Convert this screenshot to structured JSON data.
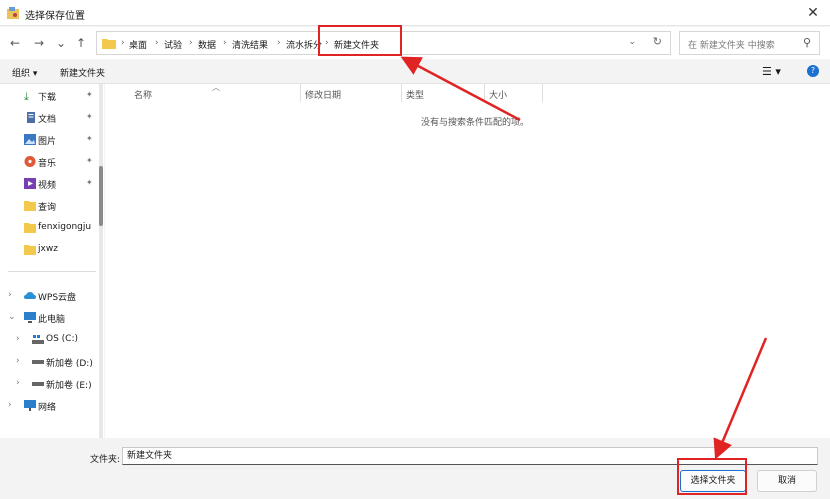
{
  "window": {
    "title": "选择保存位置",
    "close_glyph": "✕"
  },
  "nav": {
    "back": "←",
    "forward": "→",
    "recent": "⌄",
    "up": "↑"
  },
  "address": {
    "crumbs": [
      "桌面",
      "试验",
      "数据",
      "清洗结果",
      "流水拆分",
      "新建文件夹"
    ],
    "separator": "›",
    "dropdown": "⌄",
    "refresh": "↻"
  },
  "search": {
    "placeholder": "在 新建文件夹 中搜索",
    "icon": "⚲"
  },
  "toolbar": {
    "organize": "组织 ▾",
    "new_folder": "新建文件夹",
    "view": "☰ ▾",
    "help": "?"
  },
  "sidebar": {
    "items": [
      {
        "label": "下载",
        "pinned": true
      },
      {
        "label": "文档",
        "pinned": true
      },
      {
        "label": "图片",
        "pinned": true
      },
      {
        "label": "音乐",
        "pinned": true
      },
      {
        "label": "视频",
        "pinned": true
      },
      {
        "label": "查询"
      },
      {
        "label": "fenxigongju"
      },
      {
        "label": "jxwz"
      },
      {
        "label": "WPS云盘"
      },
      {
        "label": "此电脑"
      },
      {
        "label": "OS (C:)"
      },
      {
        "label": "新加卷 (D:)"
      },
      {
        "label": "新加卷 (E:)"
      },
      {
        "label": "网络"
      }
    ],
    "pin_glyph": "✦",
    "chev_right": "›",
    "chev_down": "⌄"
  },
  "content": {
    "columns": [
      "名称",
      "修改日期",
      "类型",
      "大小"
    ],
    "empty_message": "没有与搜索条件匹配的项。"
  },
  "bottom": {
    "filename_label": "文件夹:",
    "filename_value": "新建文件夹",
    "select_button": "选择文件夹",
    "cancel_button": "取消"
  },
  "colors": {
    "annotation": "#e02424",
    "accent": "#1a6fd0"
  }
}
